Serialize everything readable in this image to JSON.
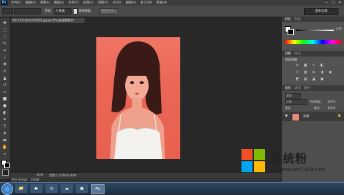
{
  "app": {
    "logo": "Ps"
  },
  "menu": {
    "items": [
      "文件(F)",
      "编辑(E)",
      "图像(I)",
      "图层(L)",
      "文字(Y)",
      "选择(S)",
      "滤镜(T)",
      "3D(D)",
      "视图(V)",
      "窗口(W)",
      "帮助(H)"
    ],
    "min": "—",
    "max": "□",
    "close": "✕"
  },
  "options": {
    "feather_label": "羽化:",
    "feather_value": "0 像素",
    "antialias_label": "消除锯齿",
    "refine_edge": "调整边缘...",
    "workspace": "基本功能"
  },
  "document": {
    "tab_title": "20141118042246528.jpg @ 40%(快速蒙版/8)",
    "zoom": "40%",
    "doc_info": "文档:1.07M/0.40M"
  },
  "minibridge": {
    "label1": "Mini Bridge",
    "label2": "时间轴"
  },
  "panels": {
    "color_tab": "颜色",
    "swatches_tab": "色板",
    "slider_value": "100",
    "adjust_tab1": "调整",
    "adjust_tab2": "样式",
    "adjust_title": "添加调整",
    "layers_tab": "图层",
    "channels_tab": "通道",
    "paths_tab": "路径",
    "kind_label": "类型",
    "mode_label": "正常",
    "opacity_label": "不透明度:",
    "opacity_value": "100%",
    "lock_label": "锁定:",
    "fill_label": "填充:",
    "fill_value": "100%",
    "layer_name": "背景"
  },
  "watermark": {
    "title": "系统粉",
    "url": "www.win7999.com"
  },
  "colors": {
    "mask": "#ea6655",
    "panel_bg": "#535353",
    "taskbar": "#1d2f44"
  }
}
